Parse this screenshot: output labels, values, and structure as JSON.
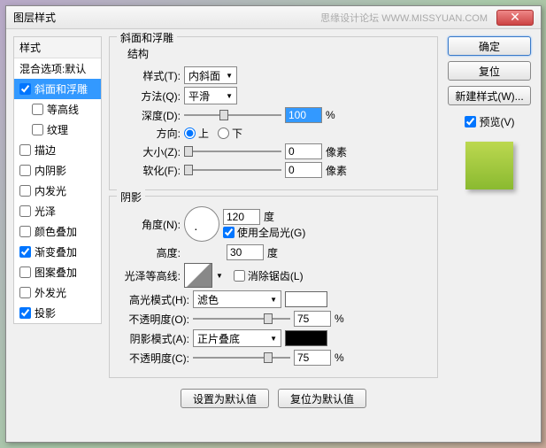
{
  "window": {
    "title": "图层样式",
    "watermark": "思缘设计论坛 WWW.MISSYUAN.COM"
  },
  "buttons": {
    "ok": "确定",
    "cancel": "复位",
    "newStyle": "新建样式(W)...",
    "preview": "预览(V)",
    "setDefault": "设置为默认值",
    "resetDefault": "复位为默认值"
  },
  "leftPanel": {
    "header": "样式",
    "blendOptions": "混合选项:默认",
    "items": [
      {
        "label": "斜面和浮雕",
        "checked": true,
        "selected": true
      },
      {
        "label": "等高线",
        "checked": false,
        "sub": true
      },
      {
        "label": "纹理",
        "checked": false,
        "sub": true
      },
      {
        "label": "描边",
        "checked": false
      },
      {
        "label": "内阴影",
        "checked": false
      },
      {
        "label": "内发光",
        "checked": false
      },
      {
        "label": "光泽",
        "checked": false
      },
      {
        "label": "颜色叠加",
        "checked": false
      },
      {
        "label": "渐变叠加",
        "checked": true
      },
      {
        "label": "图案叠加",
        "checked": false
      },
      {
        "label": "外发光",
        "checked": false
      },
      {
        "label": "投影",
        "checked": true
      }
    ]
  },
  "structure": {
    "groupTitle": "斜面和浮雕",
    "sectionTitle": "结构",
    "styleLabel": "样式(T):",
    "styleValue": "内斜面",
    "techniqueLabel": "方法(Q):",
    "techniqueValue": "平滑",
    "depthLabel": "深度(D):",
    "depthValue": "100",
    "depthUnit": "%",
    "directionLabel": "方向:",
    "directionUp": "上",
    "directionDown": "下",
    "sizeLabel": "大小(Z):",
    "sizeValue": "0",
    "sizeUnit": "像素",
    "softenLabel": "软化(F):",
    "softenValue": "0",
    "softenUnit": "像素"
  },
  "shading": {
    "sectionTitle": "阴影",
    "angleLabel": "角度(N):",
    "angleValue": "120",
    "angleUnit": "度",
    "globalLight": "使用全局光(G)",
    "altitudeLabel": "高度:",
    "altitudeValue": "30",
    "altitudeUnit": "度",
    "glossLabel": "光泽等高线:",
    "antialiased": "消除锯齿(L)",
    "highlightModeLabel": "高光模式(H):",
    "highlightModeValue": "滤色",
    "highlightOpacityLabel": "不透明度(O):",
    "highlightOpacityValue": "75",
    "opacityUnit": "%",
    "shadowModeLabel": "阴影模式(A):",
    "shadowModeValue": "正片叠底",
    "shadowOpacityLabel": "不透明度(C):",
    "shadowOpacityValue": "75"
  }
}
